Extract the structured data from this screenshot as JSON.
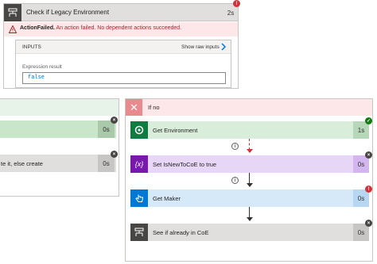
{
  "top_card": {
    "title": "Check if Legacy Environment",
    "duration": "2s",
    "badge": "!",
    "error_label": "ActionFailed.",
    "error_message": " An action failed. No dependent actions succeeded.",
    "inputs_label": "INPUTS",
    "show_raw": "Show raw inputs",
    "expression_label": "Expression result",
    "expression_value": "false"
  },
  "left_branch": {
    "step1": {
      "duration": "0s",
      "badge": "×"
    },
    "step2": {
      "label": "te it, else create",
      "duration": "0s",
      "badge": "×"
    }
  },
  "right_branch": {
    "title": "If no",
    "close_glyph": "✕",
    "steps": [
      {
        "label": "Get Environment",
        "duration": "1s",
        "badge": "✓",
        "icon": "dataverse-icon"
      },
      {
        "label": "Set IsNewToCoE to true",
        "duration": "0s",
        "badge": "×",
        "icon": "variable-icon",
        "icon_glyph": "{x}"
      },
      {
        "label": "Get Maker",
        "duration": "0s",
        "badge": "!",
        "icon": "hand-pointer-icon"
      },
      {
        "label": "See if already in CoE",
        "duration": "0s",
        "badge": "×",
        "icon": "condition-icon"
      }
    ],
    "info_glyph": "i"
  },
  "colors": {
    "error": "#d13438",
    "success": "#107c10",
    "variable": "#7719aa",
    "action_blue": "#0078d4",
    "dataverse_green": "#107c41"
  }
}
